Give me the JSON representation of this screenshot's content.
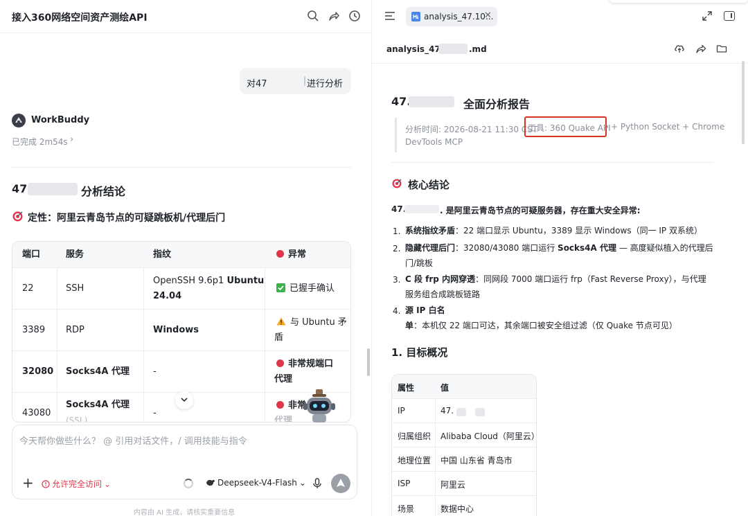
{
  "colors": {
    "accent": "#4a86e8",
    "danger": "#e0364b",
    "highlight_box": "#d93026",
    "ok": "#3bb34a",
    "warn": "#f5a623"
  },
  "chat": {
    "title": "接入360网络空间资产测绘API",
    "header_icons": [
      "search-icon",
      "share-icon",
      "history-icon"
    ],
    "user_message": {
      "prefix": "对47",
      "suffix": "进行分析"
    },
    "bot": {
      "name": "WorkBuddy",
      "status": "已完成 2m54s"
    },
    "answer": {
      "title_prefix": "47.",
      "title": "分析结论",
      "verdict": "定性：阿里云青岛节点的可疑跳板机/代理后门",
      "table": {
        "headers": [
          "端口",
          "服务",
          "指纹",
          "异常"
        ],
        "rows": [
          {
            "port": "22",
            "service": "SSH",
            "fp_a": "OpenSSH 9.6p1 ",
            "fp_b": "Ubuntu",
            "fp_c": "24.04",
            "anomaly": "已握手确认"
          },
          {
            "port": "3389",
            "service": "RDP",
            "fp_a": "",
            "fp_b": "Windows",
            "fp_c": "",
            "anomaly_a": "与 Ubuntu 矛",
            "anomaly_b": "盾"
          },
          {
            "port": "32080",
            "service": "Socks4A 代理",
            "fp_a": "-",
            "fp_b": "",
            "fp_c": "",
            "anomaly_a": "非常规端口",
            "anomaly_b": "代理"
          },
          {
            "port": "43080",
            "service": "Socks4A 代理",
            "service_sub": "(SSL)",
            "fp_a": "-",
            "fp_b": "",
            "fp_c": "",
            "anomaly_a": "非常",
            "anomaly_b": "代理"
          }
        ]
      }
    },
    "composer": {
      "placeholder": "今天帮你做些什么？ @ 引用对话文件，/ 调用技能与指令",
      "permission": "允许完全访问",
      "model": "Deepseek-V4-Flash"
    },
    "disclaimer": "内容由 AI 生成，请核实重要信息"
  },
  "doc": {
    "tab_label": "analysis_47.10...",
    "filename_prefix": "analysis_47..",
    "filename_suffix": ".md",
    "bar_icons": [
      "upload-icon",
      "share-icon",
      "folder-icon"
    ],
    "h1_prefix": "47.",
    "h1": "全面分析报告",
    "meta_line1": "分析时间: 2026-08-21 11:30 CST",
    "meta_tool": "工具: 360 Quake API",
    "meta_rest": "+ Python Socket + Chrome",
    "meta_line2": "DevTools MCP",
    "core_title": "核心结论",
    "core_lead_prefix": "47.",
    "core_lead": ". 是阿里云青岛节点的可疑服务器，存在重大安全异常:",
    "core_items": [
      {
        "num": "1.",
        "bold": "系统指纹矛盾",
        "text": "：22 端口显示 Ubuntu，3389 显示 Windows（同一 IP 双系统）"
      },
      {
        "num": "2.",
        "bold": "隐藏代理后门",
        "text": "：32080/43080 端口运行 ",
        "bold2": "Socks4A 代理",
        "text2": " — 高度疑似植入的代理后门/跳板"
      },
      {
        "num": "3.",
        "bold": "C 段 frp 内网穿透",
        "text": "：同网段 7000 端口运行 frp（Fast Reverse Proxy），与代理服务组合成跳板链路"
      },
      {
        "num": "4.",
        "bold": "源 IP 白名单",
        "text": "：本机仅 22 端口可达，其余端口被安全组过滤（仅 Quake 节点可见）"
      }
    ],
    "section1_title": "1. 目标概况",
    "attr_table": {
      "headers": [
        "属性",
        "值"
      ],
      "rows": [
        {
          "k": "IP",
          "v": "47."
        },
        {
          "k": "归属组织",
          "v": "Alibaba Cloud（阿里云）"
        },
        {
          "k": "地理位置",
          "v": "中国 山东省 青岛市"
        },
        {
          "k": "ISP",
          "v": "阿里云"
        },
        {
          "k": "场景",
          "v": "数据中心"
        }
      ]
    }
  }
}
